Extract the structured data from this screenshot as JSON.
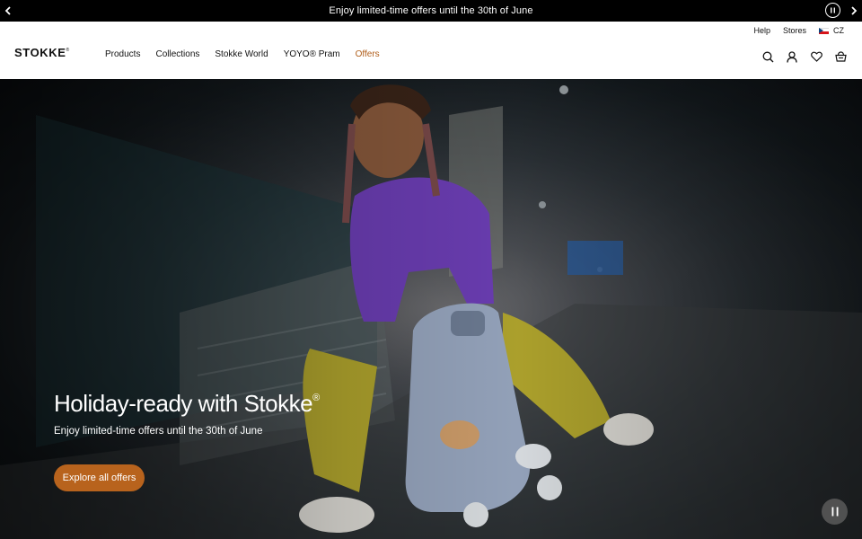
{
  "announcement": {
    "text": "Enjoy limited-time offers until the 30th of June",
    "prev_icon": "chevron-left-icon",
    "next_icon": "chevron-right-icon",
    "pause_icon": "pause-icon"
  },
  "header": {
    "logo": "STOKKE",
    "logo_mark": "®",
    "utility": {
      "help": "Help",
      "stores": "Stores",
      "country": "CZ"
    },
    "nav": [
      {
        "label": "Products"
      },
      {
        "label": "Collections"
      },
      {
        "label": "Stokke World"
      },
      {
        "label": "YOYO® Pram"
      },
      {
        "label": "Offers"
      }
    ],
    "icons": [
      "search-icon",
      "account-icon",
      "wishlist-icon",
      "basket-icon"
    ]
  },
  "hero": {
    "title": "Holiday-ready with Stokke",
    "title_mark": "®",
    "subtitle": "Enjoy limited-time offers until the 30th of June",
    "cta": "Explore all offers",
    "pause_icon": "pause-icon"
  },
  "colors": {
    "accent": "#b8631d",
    "offers_link": "#b05e1a",
    "announce_bg": "#000000"
  }
}
